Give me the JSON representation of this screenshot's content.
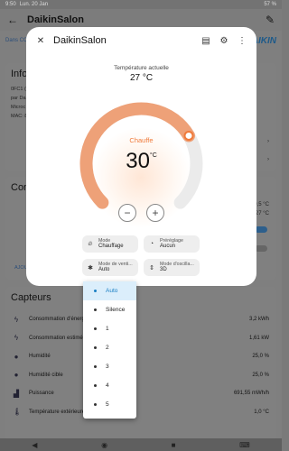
{
  "status_bar": {
    "time": "9:50",
    "date": "Lun. 20 Jan",
    "battery": "57 %"
  },
  "background": {
    "app_title": "DaikinSalon",
    "breadcrumb": "Dans CC",
    "logo": "DAIKIN",
    "info_card": {
      "title": "Info",
      "rows": [
        "0FC1 (",
        "par Da",
        "Microc",
        "MAC: 8"
      ]
    },
    "controls_card": {
      "title": "Con",
      "values": [
        "9,5 °C",
        "27 °C"
      ],
      "ajout": "AJOU"
    },
    "sensors_card": {
      "title": "Capteurs",
      "rows": [
        {
          "label": "Consommation d'énergie",
          "value": "3,2 kWh",
          "icon": "lightning-icon"
        },
        {
          "label": "Consommation estimée",
          "value": "1,61 kW",
          "icon": "lightning-icon"
        },
        {
          "label": "Humidité",
          "value": "25,0 %",
          "icon": "water-drop-icon"
        },
        {
          "label": "Humidité cible",
          "value": "25,0 %",
          "icon": "water-drop-icon"
        },
        {
          "label": "Puissance",
          "value": "691,55 mWh/h",
          "icon": "chart-icon"
        },
        {
          "label": "Température extérieure",
          "value": "1,0 °C",
          "icon": "thermometer-icon"
        }
      ]
    }
  },
  "dialog": {
    "title": "DaikinSalon",
    "current_temp_label": "Température actuelle",
    "current_temp_value": "27 °C",
    "hvac_mode_label": "Chauffe",
    "setpoint_value": "30",
    "setpoint_unit": "°C",
    "setpoint_level": 0.72,
    "accent_color": "#f07a3a",
    "track_color": "#ebebeb",
    "chips": {
      "mode": {
        "label": "Mode",
        "value": "Chauffage",
        "icon": "flame-icon"
      },
      "preset": {
        "label": "Préréglage",
        "value": "Aucun",
        "icon": "preset-icon"
      },
      "fan": {
        "label": "Mode de venti...",
        "value": "Auto",
        "icon": "fan-icon"
      },
      "swing": {
        "label": "Mode d'oscilla...",
        "value": "3D",
        "icon": "swing-icon"
      }
    }
  },
  "fan_menu": {
    "selected": "Auto",
    "options": [
      "Auto",
      "Silence",
      "1",
      "2",
      "3",
      "4",
      "5"
    ]
  }
}
